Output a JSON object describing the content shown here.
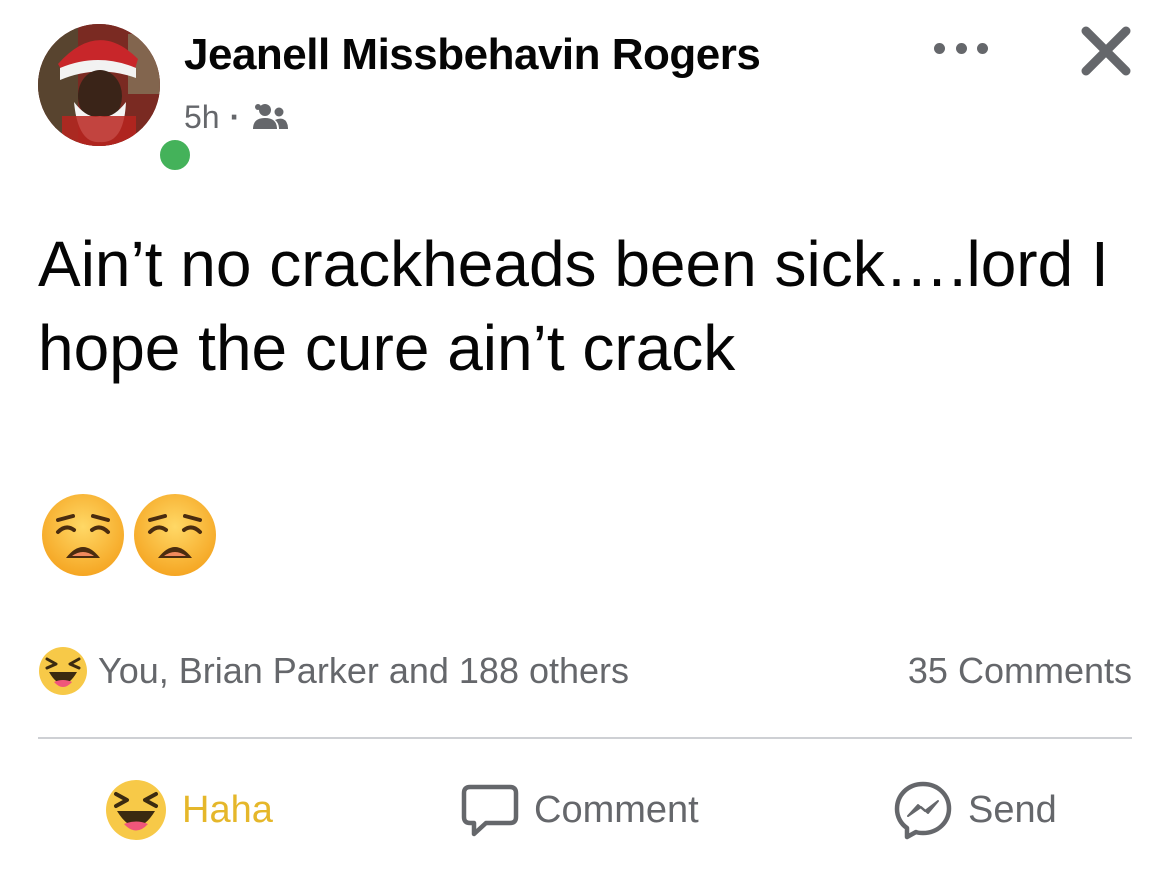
{
  "post": {
    "author_name": "Jeanell Missbehavin Rogers",
    "timestamp": "5h",
    "separator": "·",
    "audience_icon": "friends-icon",
    "online_color": "#44b25a",
    "text": "Ain’t no crackheads been sick….lord I hope the cure ain’t crack",
    "emojis": [
      "weary-face-emoji",
      "weary-face-emoji"
    ]
  },
  "header_actions": {
    "more_icon": "more-horizontal-icon",
    "close_icon": "close-icon"
  },
  "reactions": {
    "icon": "haha-reaction-icon",
    "summary": "You, Brian Parker and 188 others",
    "comments_count": "35 Comments"
  },
  "actions": {
    "haha": {
      "label": "Haha",
      "icon": "haha-reaction-icon",
      "color": "#e5b72a"
    },
    "comment": {
      "label": "Comment",
      "icon": "comment-icon"
    },
    "send": {
      "label": "Send",
      "icon": "messenger-icon"
    }
  },
  "colors": {
    "secondary_text": "#65676b",
    "primary_text": "#050505",
    "divider": "#ced0d4"
  }
}
